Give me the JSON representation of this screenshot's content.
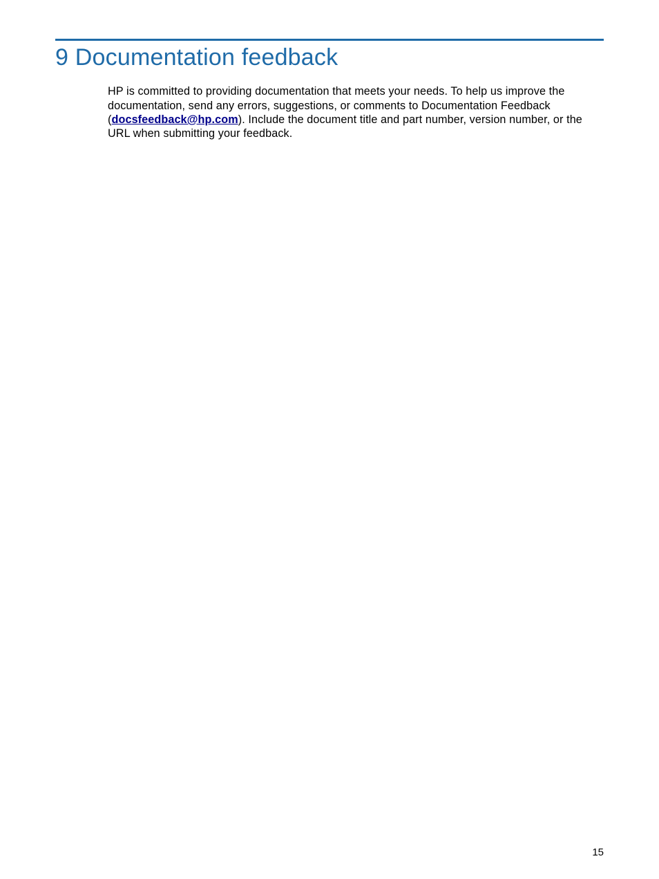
{
  "chapter": {
    "number": "9",
    "title": "Documentation feedback"
  },
  "body": {
    "text_before_link": "HP is committed to providing documentation that meets your needs. To help us improve the documentation, send any errors, suggestions, or comments to Documentation Feedback (",
    "link_text": "docsfeedback@hp.com",
    "text_after_link": "). Include the document title and part number, version number, or the URL when submitting your feedback."
  },
  "page_number": "15"
}
